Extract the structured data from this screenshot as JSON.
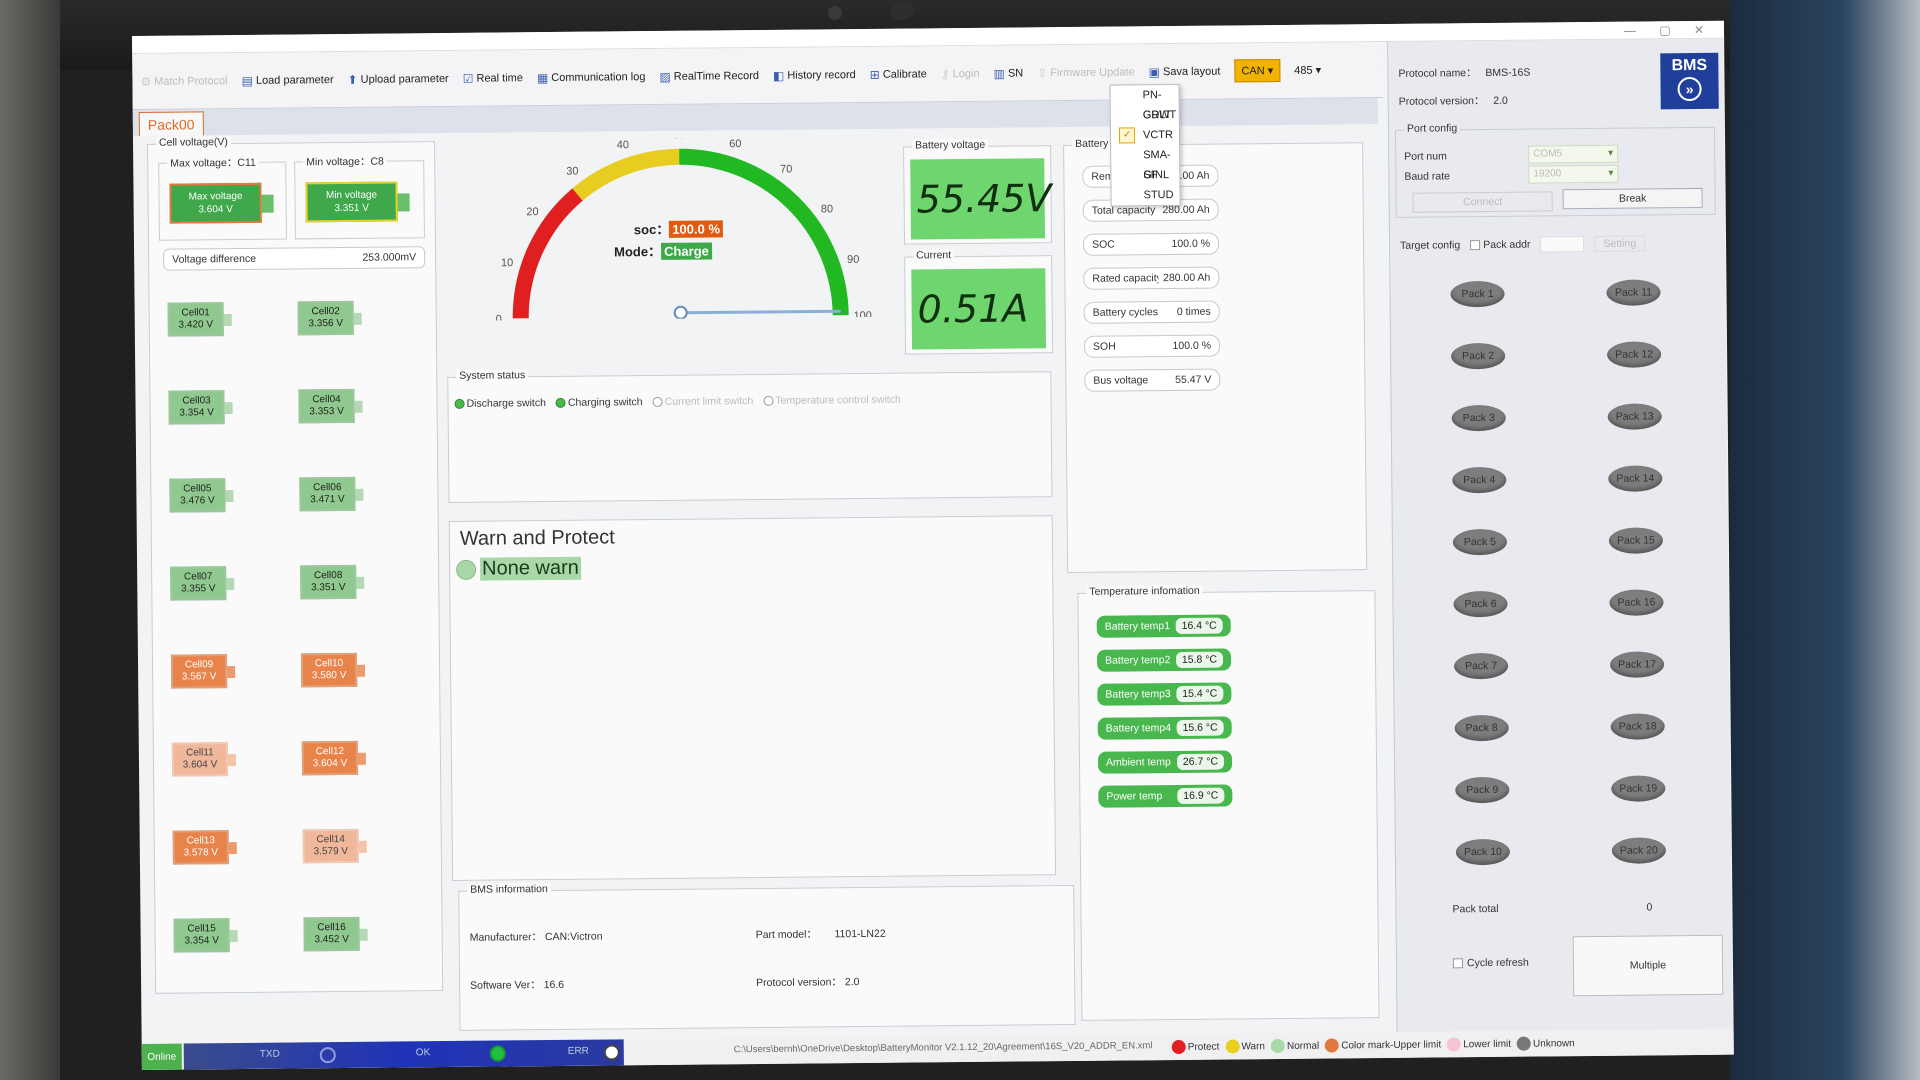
{
  "window": {
    "title_buttons": "— ▢ ✕"
  },
  "toolbar": {
    "items": [
      {
        "label": "Match Protocol",
        "icon": "match-icon",
        "disabled": true
      },
      {
        "label": "Load parameter",
        "icon": "load-icon"
      },
      {
        "label": "Upload parameter",
        "icon": "upload-icon"
      },
      {
        "label": "Real time",
        "icon": "checkbox-icon"
      },
      {
        "label": "Communication log",
        "icon": "log-icon"
      },
      {
        "label": "RealTime Record",
        "icon": "record-icon"
      },
      {
        "label": "History record",
        "icon": "history-icon"
      },
      {
        "label": "Calibrate",
        "icon": "calibrate-icon"
      },
      {
        "label": "Login",
        "icon": "login-icon",
        "disabled": true
      },
      {
        "label": "SN",
        "icon": "barcode-icon"
      },
      {
        "label": "Firmware Update",
        "icon": "firmware-icon",
        "disabled": true
      },
      {
        "label": "Sava layout",
        "icon": "save-icon"
      }
    ],
    "can_label": "CAN",
    "rs485_label": "485",
    "protocols": [
      "PN-GDLT",
      "GRWT",
      "VCTR",
      "SMA-SF",
      "GINL",
      "STUD"
    ],
    "selected_protocol": "VCTR"
  },
  "tab": {
    "label": "Pack00"
  },
  "cell_voltage": {
    "legend": "Cell voltage(V)",
    "max_label": "Max voltage：C11",
    "max_title": "Max voltage",
    "max_value": "3.604 V",
    "min_label": "Min voltage：C8",
    "min_title": "Min voltage",
    "min_value": "3.351 V",
    "diff_label": "Voltage difference",
    "diff_value": "253.000mV",
    "cells": [
      {
        "name": "Cell01",
        "value": "3.420 V",
        "state": "normal"
      },
      {
        "name": "Cell02",
        "value": "3.356 V",
        "state": "normal"
      },
      {
        "name": "Cell03",
        "value": "3.354 V",
        "state": "normal"
      },
      {
        "name": "Cell04",
        "value": "3.353 V",
        "state": "normal"
      },
      {
        "name": "Cell05",
        "value": "3.476 V",
        "state": "normal"
      },
      {
        "name": "Cell06",
        "value": "3.471 V",
        "state": "normal"
      },
      {
        "name": "Cell07",
        "value": "3.355 V",
        "state": "normal"
      },
      {
        "name": "Cell08",
        "value": "3.351 V",
        "state": "normal"
      },
      {
        "name": "Cell09",
        "value": "3.567 V",
        "state": "orange"
      },
      {
        "name": "Cell10",
        "value": "3.580 V",
        "state": "orange"
      },
      {
        "name": "Cell11",
        "value": "3.604 V",
        "state": "pale"
      },
      {
        "name": "Cell12",
        "value": "3.604 V",
        "state": "orange"
      },
      {
        "name": "Cell13",
        "value": "3.578 V",
        "state": "orange"
      },
      {
        "name": "Cell14",
        "value": "3.579 V",
        "state": "pale"
      },
      {
        "name": "Cell15",
        "value": "3.354 V",
        "state": "normal"
      },
      {
        "name": "Cell16",
        "value": "3.452 V",
        "state": "normal"
      }
    ]
  },
  "gauge": {
    "ticks": [
      "0",
      "10",
      "20",
      "30",
      "40",
      "50",
      "60",
      "70",
      "80",
      "90",
      "100"
    ],
    "soc_label": "soc：",
    "soc_value": "100.0 %",
    "soc_fraction": 1.0,
    "mode_label": "Mode：",
    "mode_value": "Charge"
  },
  "battery_voltage": {
    "legend": "Battery voltage",
    "value": "55.45V"
  },
  "current": {
    "legend": "Current",
    "value": "0.51A"
  },
  "battery": {
    "legend": "Battery",
    "fields": [
      {
        "label": "Remaining capacity",
        "value": "280.00 Ah"
      },
      {
        "label": "Total capacity",
        "value": "280.00 Ah"
      },
      {
        "label": "SOC",
        "value": "100.0 %"
      },
      {
        "label": "Rated capacity",
        "value": "280.00 Ah"
      },
      {
        "label": "Battery cycles",
        "value": "0 times"
      },
      {
        "label": "SOH",
        "value": "100.0 %"
      },
      {
        "label": "Bus voltage",
        "value": "55.47 V"
      }
    ]
  },
  "system_status": {
    "legend": "System status",
    "switches": [
      {
        "label": "Discharge switch",
        "on": true
      },
      {
        "label": "Charging switch",
        "on": true
      },
      {
        "label": "Current limit switch",
        "on": false
      },
      {
        "label": "Temperature control switch",
        "on": false
      }
    ]
  },
  "warn": {
    "title": "Warn and Protect",
    "status": "None warn"
  },
  "temperature": {
    "legend": "Temperature infomation",
    "fields": [
      {
        "label": "Battery temp1",
        "value": "16.4 °C"
      },
      {
        "label": "Battery temp2",
        "value": "15.8 °C"
      },
      {
        "label": "Battery temp3",
        "value": "15.4 °C"
      },
      {
        "label": "Battery temp4",
        "value": "15.6 °C"
      },
      {
        "label": "Ambient temp",
        "value": "26.7 °C"
      },
      {
        "label": "Power temp",
        "value": "16.9 °C"
      }
    ]
  },
  "bms_info": {
    "legend": "BMS information",
    "manufacturer_label": "Manufacturer：",
    "manufacturer": "CAN:Victron",
    "part_label": "Part model：",
    "part": "1101-LN22",
    "software_label": "Software Ver：",
    "software": "16.6",
    "protocol_label": "Protocol version：",
    "protocol": "2.0"
  },
  "right": {
    "protocol_name_label": "Protocol name：",
    "protocol_name": "BMS-16S",
    "protocol_version_label": "Protocol version：",
    "protocol_version": "2.0",
    "logo": "BMS",
    "port_legend": "Port config",
    "port_label": "Port num",
    "port_value": "COM5",
    "baud_label": "Baud rate",
    "baud_value": "19200",
    "connect": "Connect",
    "break": "Break",
    "target_legend": "Target config",
    "pack_addr": "Pack addr",
    "setting": "Setting",
    "packs": [
      "Pack 1",
      "Pack 2",
      "Pack 3",
      "Pack 4",
      "Pack 5",
      "Pack 6",
      "Pack 7",
      "Pack 8",
      "Pack 9",
      "Pack 10"
    ],
    "packs2": [
      "Pack 11",
      "Pack 12",
      "Pack 13",
      "Pack 14",
      "Pack 15",
      "Pack 16",
      "Pack 17",
      "Pack 18",
      "Pack 19",
      "Pack 20"
    ],
    "pack_total_label": "Pack total",
    "pack_total": "0",
    "cycle_refresh": "Cycle refresh",
    "multiple": "Multiple"
  },
  "statusbar": {
    "online": "Online",
    "txd": "TXD",
    "ok": "OK",
    "err": "ERR",
    "path": "C:\\Users\\bernh\\OneDrive\\Desktop\\BatteryMonitor V2.1.12_20\\Agreement\\16S_V20_ADDR_EN.xml",
    "legend": [
      "Protect",
      "Warn",
      "Normal",
      "Color mark-Upper limit",
      "Lower limit",
      "Unknown"
    ],
    "legend_colors": [
      "#e02020",
      "#e8d020",
      "#a8d8a8",
      "#e07a3c",
      "#f4c4d4",
      "#777777"
    ]
  }
}
